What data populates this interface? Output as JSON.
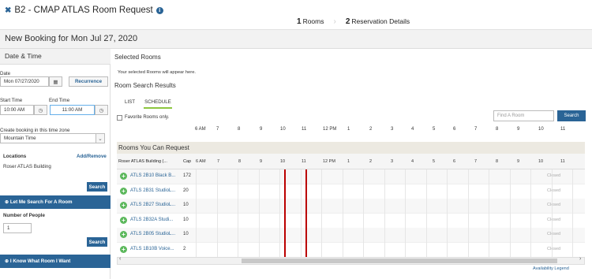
{
  "header": {
    "title": "B2 - CMAP ATLAS Room Request",
    "steps": [
      {
        "num": "1",
        "label": "Rooms"
      },
      {
        "num": "2",
        "label": "Reservation Details"
      }
    ]
  },
  "booking": {
    "title": "New Booking for Mon Jul 27, 2020"
  },
  "left": {
    "date_time_header": "Date & Time",
    "date_label": "Date",
    "date_value": "Mon 07/27/2020",
    "recurrence_label": "Recurrence",
    "start_time_label": "Start Time",
    "start_time_value": "10:00 AM",
    "end_time_label": "End Time",
    "end_time_value": "11:00 AM",
    "timezone_label": "Create booking in this time zone",
    "timezone_value": "Mountain Time",
    "locations_label": "Locations",
    "add_remove_label": "Add/Remove",
    "location_value": "Roser ATLAS Building",
    "search_label": "Search",
    "let_me_search_label": "Let Me Search For A Room",
    "number_people_label": "Number of People",
    "number_people_value": "1",
    "search2_label": "Search",
    "i_know_label": "I Know What Room I Want"
  },
  "right": {
    "selected_rooms_title": "Selected Rooms",
    "selected_rooms_text": "Your selected Rooms will appear here.",
    "results_title": "Room Search Results",
    "tabs": [
      "LIST",
      "SCHEDULE"
    ],
    "favorite_label": "Favorite Rooms only.",
    "find_placeholder": "Find A Room",
    "search_btn": "Search",
    "times_top": [
      "6 AM",
      "7",
      "8",
      "9",
      "10",
      "11",
      "12 PM",
      "1",
      "2",
      "3",
      "4",
      "5",
      "6",
      "7",
      "8",
      "9",
      "10",
      "11"
    ],
    "rooms_header": "Rooms You Can Request",
    "col_room": "Roser ATLAS Building (...",
    "col_cap": "Cap",
    "times_grid": [
      "6 AM",
      "7",
      "8",
      "9",
      "10",
      "11",
      "12 PM",
      "1",
      "2",
      "3",
      "4",
      "5",
      "6",
      "7",
      "8",
      "9",
      "10",
      "11"
    ],
    "rooms": [
      {
        "name": "ATLS 2B10 Black B...",
        "cap": "172",
        "status": "Closed"
      },
      {
        "name": "ATLS 2B31 StudioL...",
        "cap": "20",
        "status": "Closed"
      },
      {
        "name": "ATLS 2B27 StudioL...",
        "cap": "10",
        "status": "Closed"
      },
      {
        "name": "ATLS 2B32A Studi...",
        "cap": "10",
        "status": "Closed"
      },
      {
        "name": "ATLS 2B05 StudioL...",
        "cap": "10",
        "status": "Closed"
      },
      {
        "name": "ATLS 1B10B Voice...",
        "cap": "2",
        "status": "Closed"
      }
    ],
    "legend_label": "Availability Legend"
  },
  "icons": {
    "calendar": "calendar-icon",
    "clock": "clock-icon",
    "info": "info-icon",
    "close": "close-icon"
  },
  "colors": {
    "accent_blue": "#2a6496",
    "accent_green": "#8dc63f",
    "red_line": "#b00000"
  }
}
